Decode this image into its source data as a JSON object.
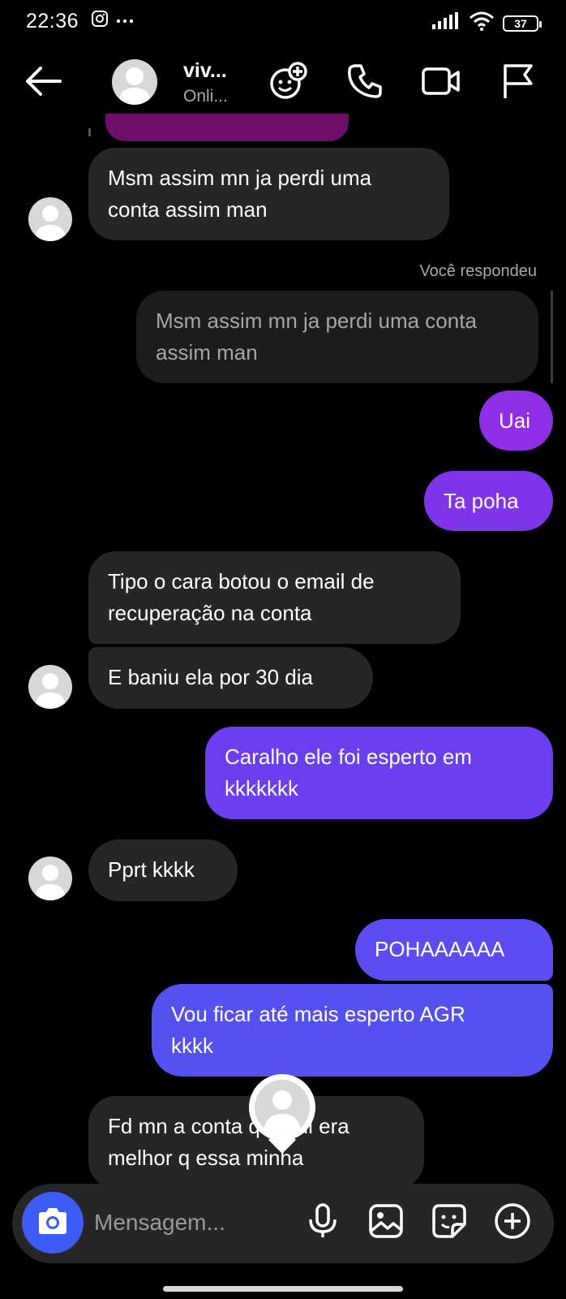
{
  "status_bar": {
    "time": "22:36",
    "battery": "37"
  },
  "header": {
    "name": "viv...",
    "status": "Onli..."
  },
  "messages": [
    {
      "side": "in",
      "text": "Msm assim mn ja perdi uma\nconta assim man"
    },
    {
      "side": "out",
      "reply_label": "Você respondeu",
      "quoted": "Msm assim mn ja perdi uma conta\nassim man"
    },
    {
      "side": "out",
      "text": "Uai"
    },
    {
      "side": "out",
      "text": "Ta poha"
    },
    {
      "side": "in",
      "text": "Tipo o cara botou o email de\nrecuperação na conta"
    },
    {
      "side": "in",
      "text": "E baniu ela por 30 dia"
    },
    {
      "side": "out",
      "text": "Caralho ele foi esperto em\nkkkkkkk"
    },
    {
      "side": "in",
      "text": "Pprt kkkk"
    },
    {
      "side": "out",
      "text": "POHAAAAAA"
    },
    {
      "side": "out",
      "text": "Vou ficar até mais esperto AGR\nkkkk"
    },
    {
      "side": "in",
      "text": "Fd mn a conta q perdi era\nmelhor q essa minha"
    }
  ],
  "composer": {
    "placeholder": "Mensagem..."
  },
  "colors": {
    "background": "#000000",
    "incoming_bubble": "#262626",
    "outgoing_pink": "#8e2ee6",
    "outgoing_purple": "#6b3ff0",
    "outgoing_blue": "#5551f0",
    "camera_button": "#3d5bf5"
  },
  "icons": [
    "back-arrow-icon",
    "effects-icon",
    "phone-icon",
    "video-icon",
    "flag-icon",
    "camera-icon",
    "microphone-icon",
    "gallery-icon",
    "sticker-icon",
    "plus-icon"
  ]
}
